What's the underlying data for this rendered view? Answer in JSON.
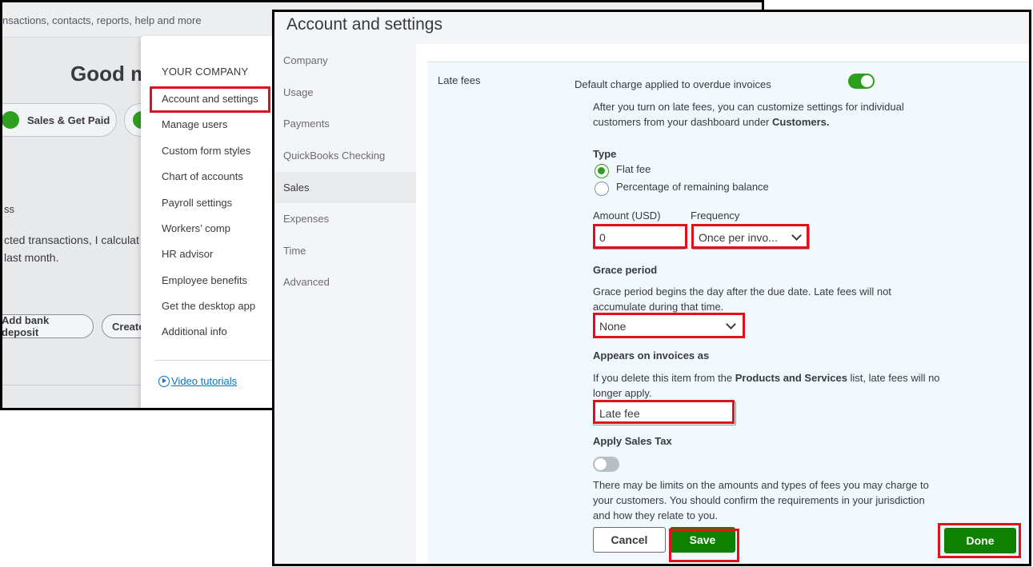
{
  "background": {
    "search_placeholder": "nsactions, contacts, reports, help and more",
    "greeting": "Good m",
    "pills": [
      "Sales & Get Paid"
    ],
    "section_label": "ss",
    "body_text": "cted transactions, I calculat last month.",
    "action_pills": [
      "Add bank deposit",
      "Create"
    ],
    "gear_menu": {
      "section_title": "YOUR COMPANY",
      "items": [
        "Account and settings",
        "Manage users",
        "Custom form styles",
        "Chart of accounts",
        "Payroll settings",
        "Workers’ comp",
        "HR advisor",
        "Employee benefits",
        "Get the desktop app",
        "Additional info"
      ],
      "video_link": "Video tutorials"
    }
  },
  "settings": {
    "title": "Account and settings",
    "nav": [
      "Company",
      "Usage",
      "Payments",
      "QuickBooks Checking",
      "Sales",
      "Expenses",
      "Time",
      "Advanced"
    ],
    "active_nav": "Sales",
    "late_fees": {
      "label": "Late fees",
      "toggle_label": "Default charge applied to overdue invoices",
      "toggle_on": true,
      "intro_text": "After you turn on late fees, you can customize settings for individual customers from your dashboard under ",
      "intro_bold": "Customers.",
      "type_label": "Type",
      "type_options": [
        "Flat fee",
        "Percentage of remaining balance"
      ],
      "type_selected": "Flat fee",
      "amount_label": "Amount (USD)",
      "amount_value": "0",
      "frequency_label": "Frequency",
      "frequency_value": "Once per invo...",
      "grace_label": "Grace period",
      "grace_help": "Grace period begins the day after the due date. Late fees will not accumulate during that time.",
      "grace_value": "None",
      "appears_label": "Appears on invoices as",
      "appears_help_pre": "If you delete this item from the ",
      "appears_help_bold": "Products and Services",
      "appears_help_post": " list, late fees will no longer apply.",
      "appears_value": "Late fee",
      "tax_label": "Apply Sales Tax",
      "tax_on": false,
      "disclaimer": "There may be limits on the amounts and types of fees you may charge to your customers. You should confirm the requirements in your jurisdiction and how they relate to you.",
      "cancel_label": "Cancel",
      "save_label": "Save"
    },
    "done_label": "Done"
  },
  "colors": {
    "accent_green": "#2ca01c",
    "button_green": "#108000",
    "highlight_red": "#e0121c",
    "link_blue": "#0077c5"
  }
}
